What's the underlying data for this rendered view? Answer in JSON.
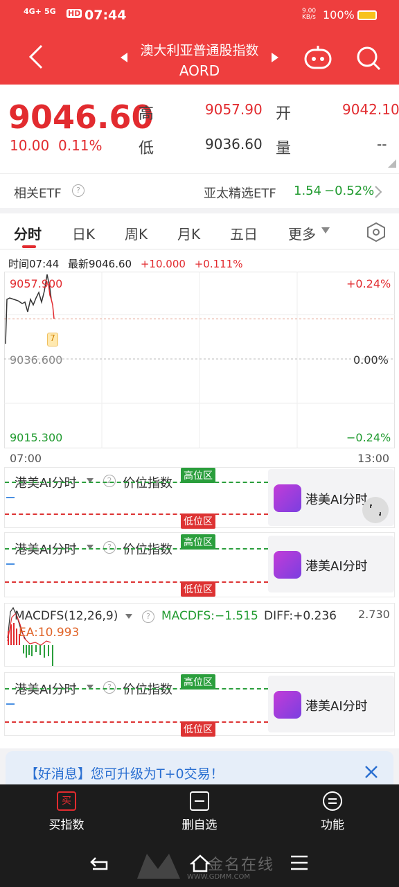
{
  "status_bar": {
    "net_left": "4G+",
    "net_right": "5G",
    "hd": "HD",
    "time": "07:44",
    "speed": "9.00 KB/s",
    "battery": "100%"
  },
  "header": {
    "title_cn": "澳大利亚普通股指数",
    "title_code": "AORD"
  },
  "quote": {
    "price": "9046.60",
    "change": "10.00",
    "change_pct": "0.11%",
    "high_label": "高",
    "high": "9057.90",
    "open_label": "开",
    "open": "9042.10",
    "low_label": "低",
    "low": "9036.60",
    "vol_label": "量",
    "vol": "--"
  },
  "etf": {
    "label": "相关ETF",
    "name": "亚太精选ETF",
    "price": "1.54",
    "pct": "−0.52%"
  },
  "tabs": [
    "分时",
    "日K",
    "周K",
    "月K",
    "五日",
    "更多"
  ],
  "info_bar": {
    "time_label": "时间",
    "time": "07:44",
    "latest_label": "最新",
    "latest": "9046.60",
    "chg": "+10.000",
    "chg_pct": "+0.111%"
  },
  "chart": {
    "y_top": "9057.900",
    "y_mid": "9036.600",
    "y_bot": "9015.300",
    "pct_top": "+0.24%",
    "pct_mid": "0.00%",
    "pct_bot": "−0.24%",
    "x_start": "07:00",
    "x_end": "13:00",
    "marker": "7"
  },
  "ai_panel": {
    "name": "港美AI分时",
    "indicator": "价位指数",
    "high_zone": "高位区",
    "low_zone": "低位区",
    "card_text": "港美AI分时"
  },
  "macd": {
    "name": "MACDFS(12,26,9)",
    "macdfs": "MACDFS:−1.515",
    "diff": "DIFF:+0.236",
    "ea": "EA:10.993",
    "scale": "2.730"
  },
  "banner": {
    "text": "【好消息】您可升级为T+0交易！"
  },
  "bottom": {
    "buy": "买指数",
    "remove": "删自选",
    "func": "功能",
    "buy_icon": "买"
  },
  "watermark": {
    "text": "金名在线",
    "url": "WWW.GDMM.COM"
  },
  "colors": {
    "header": "#ee3e3e",
    "up": "#e22b2f",
    "down": "#1f9a2e"
  }
}
